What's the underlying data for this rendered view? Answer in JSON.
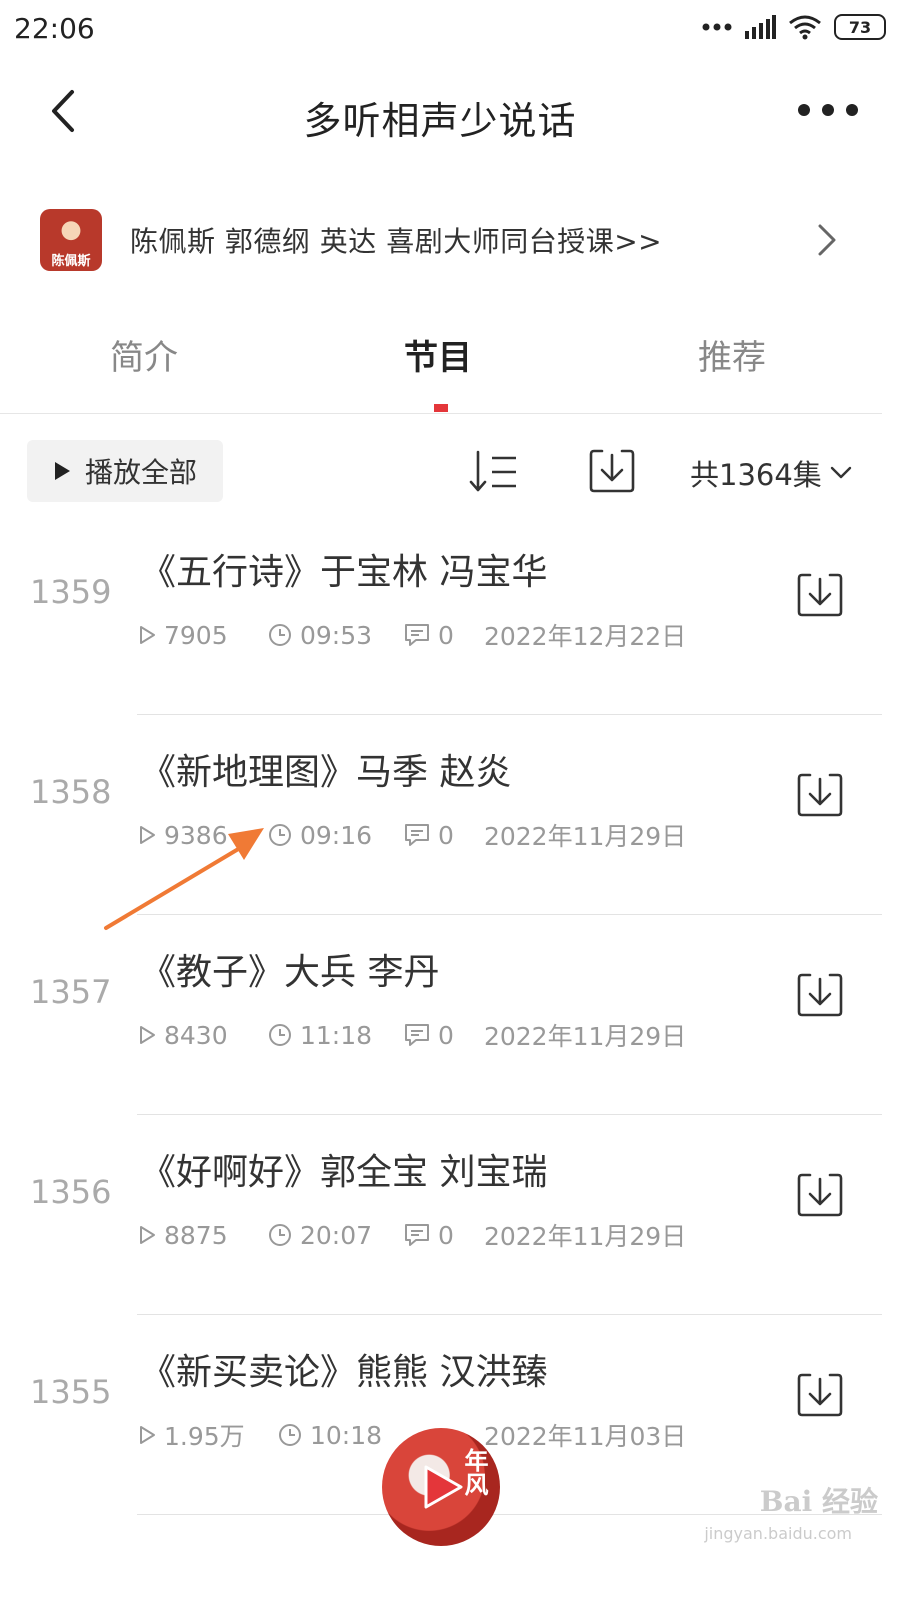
{
  "status_bar": {
    "time": "22:06",
    "battery": "73"
  },
  "header": {
    "title": "多听相声少说话"
  },
  "promo": {
    "thumb_text": "陈佩斯",
    "text": "陈佩斯  郭德纲 英达 喜剧大师同台授课>>"
  },
  "tabs": [
    {
      "label": "简介"
    },
    {
      "label": "节目",
      "active": true
    },
    {
      "label": "推荐"
    }
  ],
  "toolbar": {
    "play_all_label": "播放全部",
    "episode_count": "共1364集"
  },
  "episodes": [
    {
      "number": "1359",
      "title": "《五行诗》于宝林 冯宝华",
      "plays": "7905",
      "duration": "09:53",
      "comments": "0",
      "date": "2022年12月22日"
    },
    {
      "number": "1358",
      "title": "《新地理图》马季 赵炎",
      "plays": "9386",
      "duration": "09:16",
      "comments": "0",
      "date": "2022年11月29日"
    },
    {
      "number": "1357",
      "title": "《教子》大兵 李丹",
      "plays": "8430",
      "duration": "11:18",
      "comments": "0",
      "date": "2022年11月29日"
    },
    {
      "number": "1356",
      "title": "《好啊好》郭全宝 刘宝瑞",
      "plays": "8875",
      "duration": "20:07",
      "comments": "0",
      "date": "2022年11月29日"
    },
    {
      "number": "1355",
      "title": "《新买卖论》熊熊 汉洪臻",
      "plays": "1.95万",
      "duration": "10:18",
      "comments": "",
      "date": "2022年11月03日"
    }
  ],
  "player": {
    "cover_text": "年风"
  },
  "watermark": {
    "brand": "Bai 经验",
    "url": "jingyan.baidu.com"
  },
  "colors": {
    "accent": "#e4363a",
    "annotation_arrow": "#f07a35"
  }
}
